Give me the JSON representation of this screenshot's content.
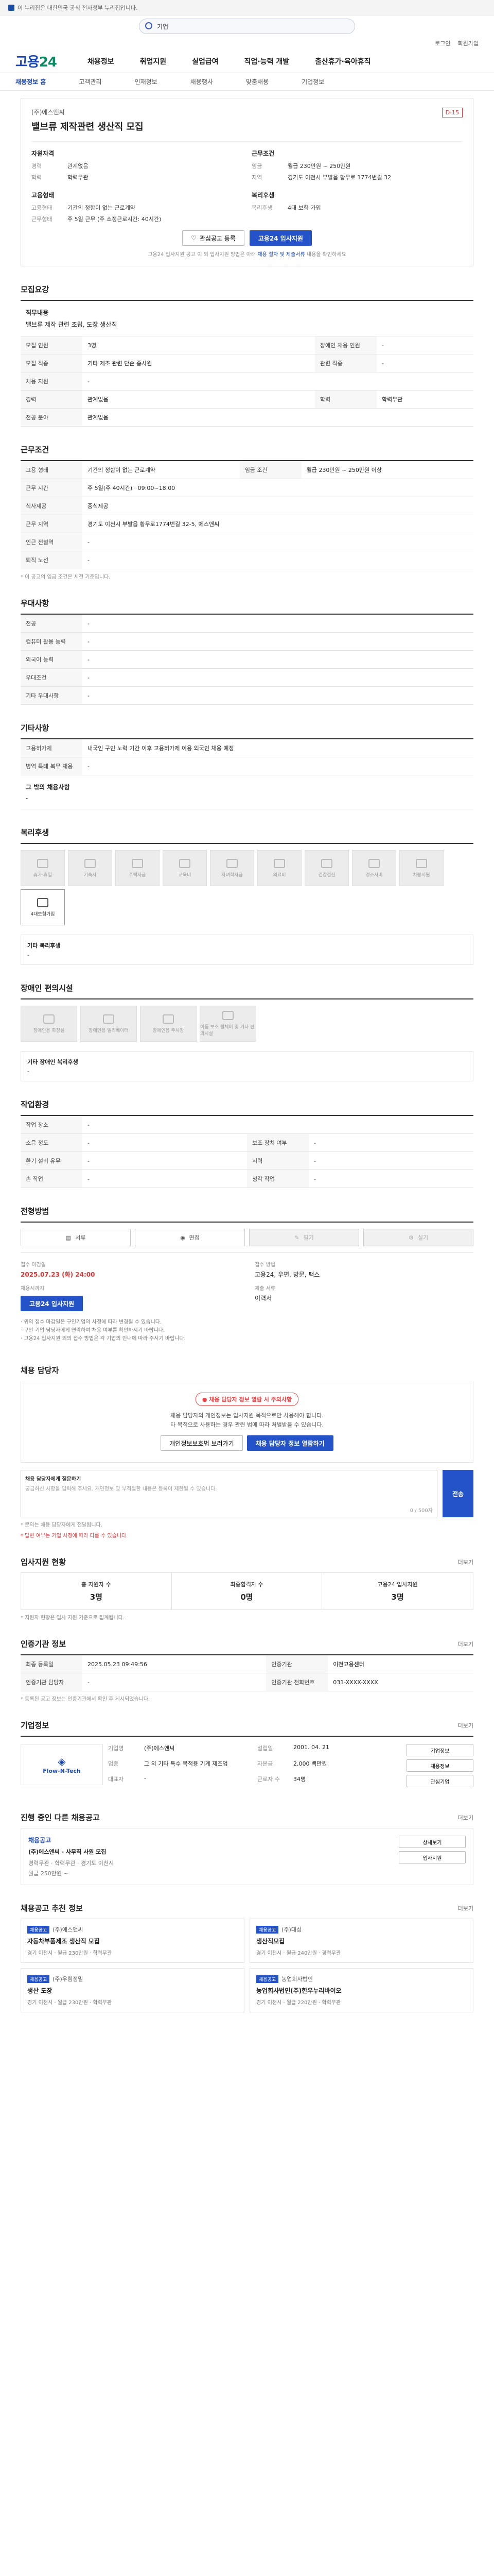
{
  "top": {
    "notice": "이 누리집은 대한민국 공식 전자정부 누리집입니다."
  },
  "search": {
    "value": "기업"
  },
  "util": {
    "login": "로그인",
    "join": "회원가입"
  },
  "gnb": {
    "logo_a": "고용",
    "logo_b": "24",
    "menu": [
      "채용정보",
      "취업지원",
      "실업급여",
      "직업·능력 개발",
      "출산휴가·육아휴직"
    ]
  },
  "lnb": [
    "채용정보 홈",
    "고객관리",
    "인재정보",
    "채용행사",
    "맞춤채용",
    "기업정보"
  ],
  "job": {
    "company": "(주)에스앤씨",
    "title": "밸브류 제작관련 생산직 모집",
    "dday": "D-15",
    "left_heading": "자원자격",
    "left": [
      [
        "경력",
        "관계없음"
      ],
      [
        "학력",
        "학력무관"
      ]
    ],
    "right_heading": "근무조건",
    "right": [
      [
        "임금",
        "월급 230만원 ~ 250만원"
      ],
      [
        "지역",
        "경기도 이천시 부발읍 황무로 1774번길 32"
      ]
    ],
    "left2_heading": "고용형태",
    "left2": [
      [
        "고용형태",
        "기간의 정함이 없는 근로계약"
      ],
      [
        "근무형태",
        "주 5일 근무 (주 소정근로시간: 40시간)"
      ]
    ],
    "right2_heading": "복리후생",
    "right2": [
      [
        "복리후생",
        "4대 보험 가입"
      ]
    ],
    "scrap": "관심공고 등록",
    "apply": "고용24 입사지원",
    "note_a": "고용24 입사지원 공고 이 외 입사지원 방법은 아래",
    "note_b": "채용 절차 및 제출서류",
    "note_c": "내용을 확인하세요"
  },
  "recruit": {
    "title": "모집요강",
    "duty_label": "직무내용",
    "duty": "밸브류 제작 관련 조립, 도장 생산직",
    "rows": [
      [
        "모집 인원",
        "3명",
        "장애인 채용 인원",
        "-"
      ],
      [
        "모집 직종",
        "기타 제조 관련 단순 종사원",
        "관련 직종",
        "-"
      ],
      [
        "채용 지원",
        "-",
        "",
        ""
      ],
      [
        "경력",
        "관계없음",
        "학력",
        "학력무관"
      ],
      [
        "전공 분야",
        "관계없음",
        "",
        ""
      ]
    ]
  },
  "work": {
    "title": "근무조건",
    "rows": [
      [
        "고용 형태",
        "기간의 정함이 없는 근로계약",
        "임금 조건",
        "월급 230만원 ~ 250만원 이상"
      ],
      [
        "근무 시간",
        "주 5일(주 40시간)",
        "",
        ""
      ],
      [
        "식사제공",
        "중식제공",
        "",
        ""
      ],
      [
        "근무 지역",
        "경기도 이천시 부발읍 황무로1774번길 32-5, 에스앤씨",
        "",
        ""
      ],
      [
        "인근 전철역",
        "-",
        "",
        ""
      ],
      [
        "퇴직 노선",
        "-",
        "",
        ""
      ]
    ],
    "worktime": "09:00~18:00",
    "caution": "* 이 공고의 임금 조건은 세전 기준입니다."
  },
  "pref": {
    "title": "우대사항",
    "rows": [
      [
        "전공",
        "-"
      ],
      [
        "컴퓨터 활용 능력",
        "-"
      ],
      [
        "외국어 능력",
        "-"
      ],
      [
        "우대조건",
        "-"
      ],
      [
        "기타 우대사항",
        "-"
      ]
    ]
  },
  "etc": {
    "title": "기타사항",
    "rows": [
      [
        "고용허가제",
        "내국인 구인 노력 기간 이후 고용허가제 이용 외국인 채용 예정"
      ],
      [
        "병역 특례 복무 채용",
        "-"
      ]
    ],
    "extra_label": "그 밖의 채용사항",
    "extra": "-"
  },
  "welfare": {
    "title": "복리후생",
    "tiles": [
      "휴가·휴일",
      "기숙사",
      "주택자금",
      "교육비",
      "자녀학자금",
      "의료비",
      "건강검진",
      "경조사비",
      "차량지원",
      "4대보험가입"
    ],
    "extra_label": "기타 복리후생",
    "extra": "-"
  },
  "disability": {
    "title": "장애인 편의시설",
    "tiles": [
      "장애인용 화장실",
      "장애인용 엘리베이터",
      "장애인용 주차장",
      "이동 보조 휠체어 및 기타 편의시설"
    ],
    "extra_label": "기타 장애인 복리후생",
    "extra": "-"
  },
  "env": {
    "title": "작업환경",
    "rows": [
      [
        "작업 장소",
        "-",
        "",
        ""
      ],
      [
        "소음 정도",
        "-",
        "보조 장치 여부",
        "-"
      ],
      [
        "환기 설비 유무",
        "-",
        "시력",
        "-"
      ],
      [
        "손 작업",
        "-",
        "청각 작업",
        "-"
      ]
    ]
  },
  "process": {
    "title": "전형방법",
    "steps": [
      "서류",
      "면접",
      "필기",
      "실기"
    ],
    "deadline_label": "접수 마감일",
    "deadline": "2025.07.23 (화) 24:00",
    "deadline_note": "채용시까지",
    "method_label": "접수 방법",
    "method": "고용24, 우편, 방문, 팩스",
    "docs_label": "제출 서류",
    "docs": "이력서",
    "apply": "고용24 입사지원",
    "bullets": [
      "· 위의 접수 마감일은 구인기업의 사정에 따라 변경될 수 있습니다.",
      "· 구인 기업 담당자에게 연락하여 채용 여부를 확인하시기 바랍니다.",
      "· 고용24 입사지원 외의 접수 방법은 각 기업의 안내에 따라 주시기 바랍니다."
    ]
  },
  "manager": {
    "title": "채용 담당자",
    "badge": "채용 담당자 정보 열람 시 주의사항",
    "desc_a": "채용 담당자의 개인정보는 입사지원 목적으로만 사용해야 합니다.",
    "desc_b": "타 목적으로 사용하는 경우 관련 법에 따라 처벌받을 수 있습니다.",
    "btn_a": "개인정보보호법 보러가기",
    "btn_b": "채용 담당자 정보 열람하기"
  },
  "inquiry": {
    "title": "채용 담당자에게 질문하기",
    "placeholder": "궁금하신 사항을 입력해 주세요. 개인정보 및 부적절한 내용은 등록이 제한될 수 있습니다.",
    "counter": "0 / 500자",
    "send": "전송",
    "note_a": "* 문의는 채용 담당자에게 전달됩니다.",
    "note_b": "* 답변 여부는 기업 사정에 따라 다를 수 있습니다."
  },
  "apply_status": {
    "title": "입사지원 현황",
    "more": "더보기",
    "stats": [
      [
        "총 지원자 수",
        "3명"
      ],
      [
        "최종합격자 수",
        "0명"
      ],
      [
        "고용24 입사지원",
        "3명"
      ]
    ],
    "note": "* 지원자 현황은 입사 지원 기준으로 집계됩니다."
  },
  "reg": {
    "title": "인증기관 정보",
    "more": "더보기",
    "rows": [
      [
        "최종 등록일",
        "2025.05.23 09:49:56",
        "인증기관",
        "이천고용센터"
      ],
      [
        "인증기관 담당자",
        "-",
        "인증기관 전화번호",
        "031-XXXX-XXXX"
      ]
    ],
    "caution": "* 등록된 공고 정보는 인증기관에서 확인 후 게시되었습니다."
  },
  "company": {
    "title": "기업정보",
    "more": "더보기",
    "logo_name": "Flow-N-Tech",
    "rows_a": [
      [
        "기업명",
        "(주)에스앤씨"
      ],
      [
        "업종",
        "그 외 기타 특수 목적용 기계 제조업"
      ],
      [
        "대표자",
        "-"
      ]
    ],
    "rows_b": [
      [
        "설립일",
        "2001. 04. 21"
      ],
      [
        "자본금",
        "2,000 백만원"
      ],
      [
        "근로자 수",
        "34명"
      ]
    ],
    "btns": [
      "기업정보",
      "채용정보",
      "관심기업"
    ]
  },
  "other": {
    "title": "진행 중인 다른 채용공고",
    "more": "더보기",
    "org": "채용공고",
    "job": "(주)에스앤씨 - 사무직 사원 모집",
    "meta": "경력무관 · 학력무관 · 경기도 이천시",
    "pay": "월급 250만원 ~",
    "btns": [
      "상세보기",
      "입사지원"
    ]
  },
  "reco": {
    "title": "채용공고 추천 정보",
    "more": "더보기",
    "cards": [
      {
        "tag": "채용공고",
        "co": "(주)에스앤씨",
        "t": "자동차부품제조 생산직 모집",
        "m": "경기 이천시 · 월급 230만원 · 학력무관"
      },
      {
        "tag": "채용공고",
        "co": "(주)대성",
        "t": "생산직모집",
        "m": "경기 이천시 · 월급 240만원 · 경력무관"
      },
      {
        "tag": "채용공고",
        "co": "(주)우림정밀",
        "t": "생산 도장",
        "m": "경기 이천시 · 월급 230만원 · 학력무관"
      },
      {
        "tag": "채용공고",
        "co": "농업회사법인",
        "t": "농업회사법인(주)한우누리바이오",
        "m": "경기 이천시 · 월급 220만원 · 학력무관"
      }
    ]
  }
}
